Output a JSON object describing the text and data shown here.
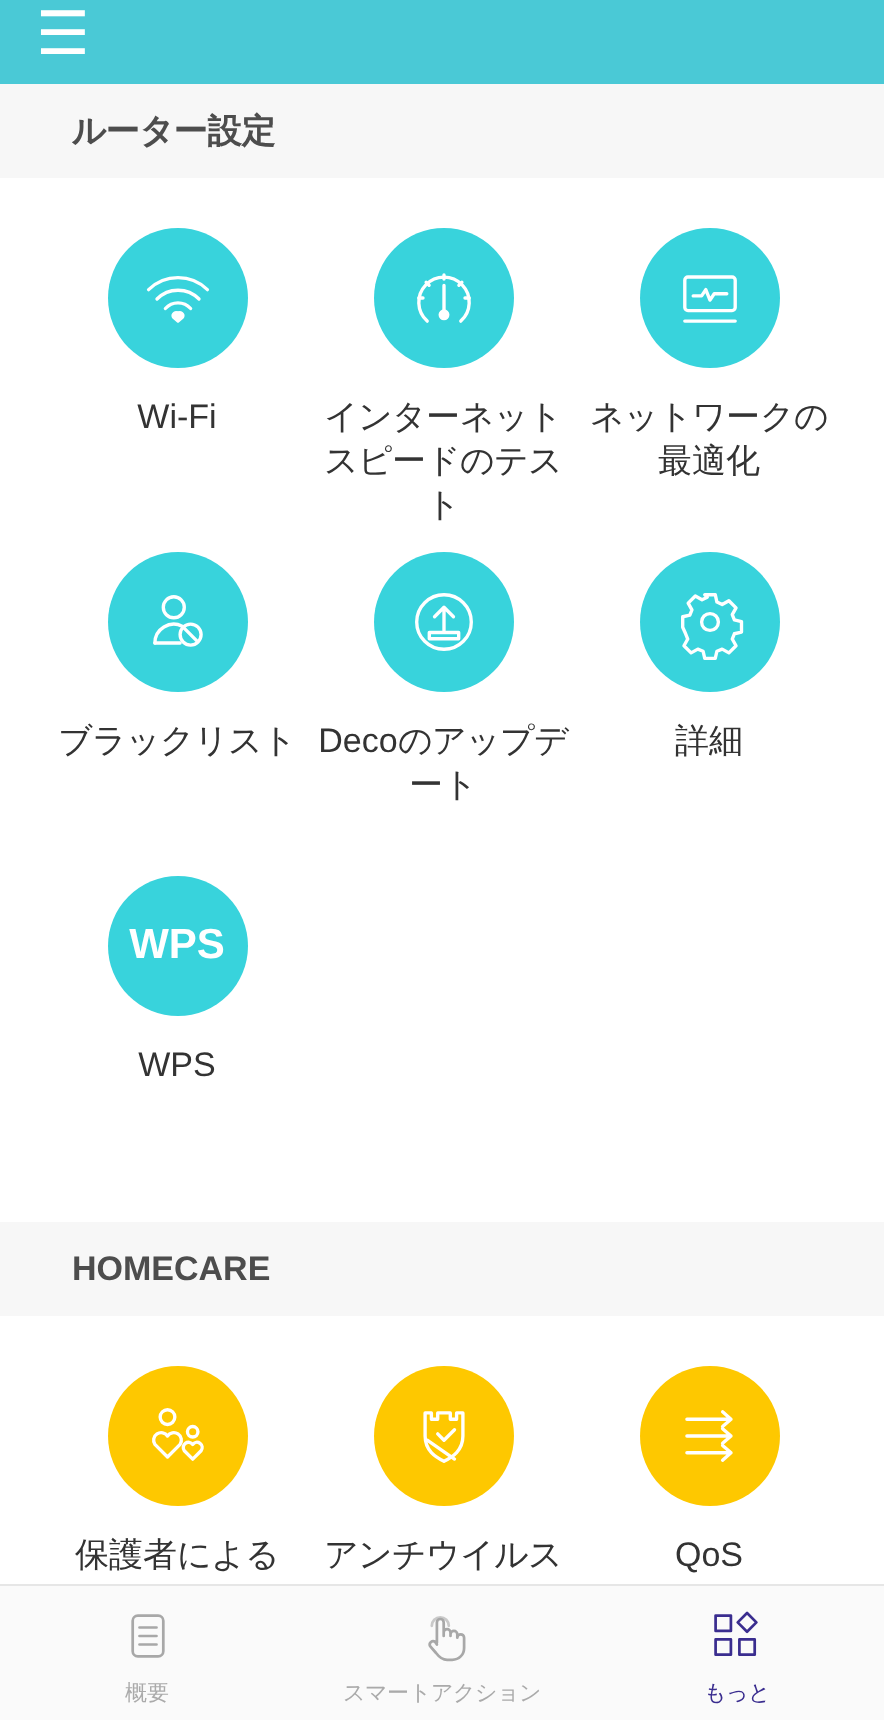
{
  "header": {
    "menu_icon": "☰"
  },
  "sections": [
    {
      "title": "ルーター設定",
      "color": "#38d3dc",
      "items": [
        {
          "label": "Wi-Fi"
        },
        {
          "label": "インターネットスピードのテスト"
        },
        {
          "label": "ネットワークの最適化"
        },
        {
          "label": "ブラックリスト"
        },
        {
          "label": "Decoのアップデート"
        },
        {
          "label": "詳細"
        },
        {
          "label": "WPS",
          "icon_text": "WPS"
        }
      ]
    },
    {
      "title": "HOMECARE",
      "color": "#fec800",
      "items": [
        {
          "label": "保護者による"
        },
        {
          "label": "アンチウイルス"
        },
        {
          "label": "QoS"
        }
      ]
    }
  ],
  "tabs": [
    {
      "label": "概要",
      "selected": false
    },
    {
      "label": "スマートアクション",
      "selected": false
    },
    {
      "label": "もっと",
      "selected": true
    }
  ]
}
